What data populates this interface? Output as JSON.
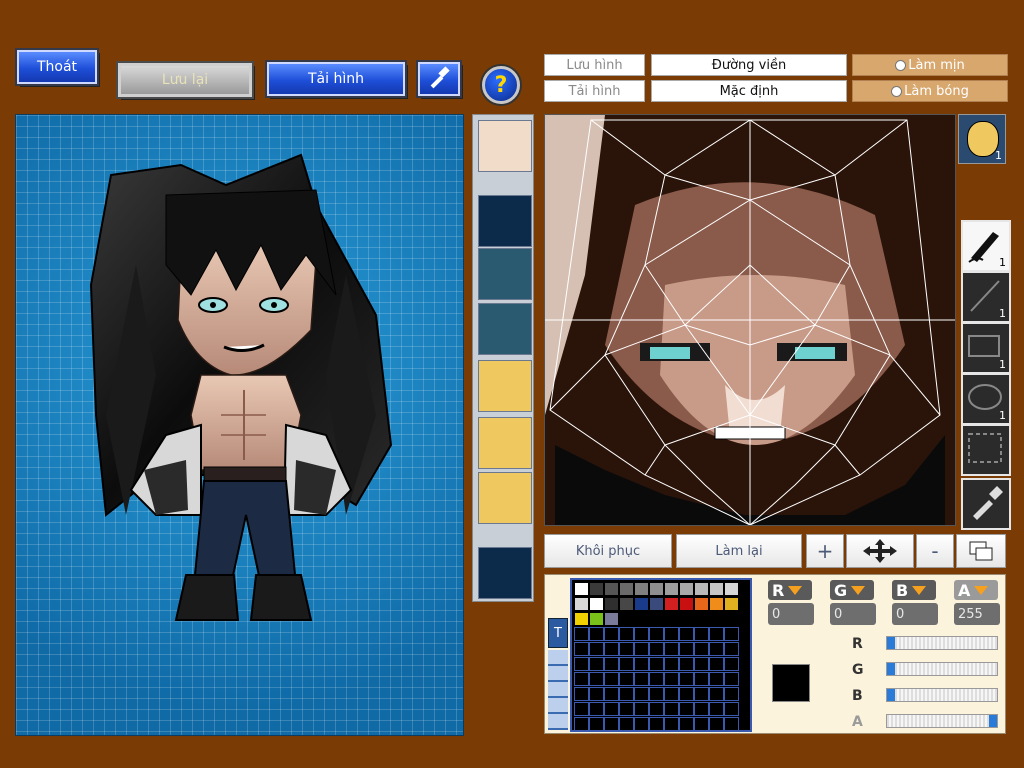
{
  "toolbar": {
    "exit_label": "Thoát",
    "save_label": "Lưu lại",
    "load_label": "Tải hình",
    "help_glyph": "?"
  },
  "face_tabs": {
    "save_image": "Lưu hình",
    "load_image": "Tải hình",
    "outline": "Đường viền",
    "default": "Mặc định",
    "smooth": "Làm mịn",
    "shade": "Làm bóng"
  },
  "face_actions": {
    "restore": "Khôi phục",
    "redo": "Làm lại",
    "plus": "+",
    "minus": "-"
  },
  "tools": [
    {
      "name": "pen-tool",
      "count": "1"
    },
    {
      "name": "line-tool",
      "count": "1"
    },
    {
      "name": "rectangle-tool",
      "count": "1"
    },
    {
      "name": "ellipse-tool",
      "count": "1"
    },
    {
      "name": "select-tool",
      "count": ""
    },
    {
      "name": "eyedropper-tool",
      "count": ""
    }
  ],
  "face_thumb_badge": "1",
  "palette": {
    "tab_label": "T",
    "colors_row1": [
      "#ffffff",
      "#3a3a3a",
      "#555555",
      "#6a6a6a",
      "#808080",
      "#8f8f8f",
      "#9e9e9e",
      "#a8a8a8",
      "#b9b9b9",
      "#c6c6c6",
      "#d6d6d6"
    ],
    "colors_row2": [
      "#d8d8d8",
      "#ffffff",
      "#2f2f2f",
      "#474747",
      "#1a3a8c",
      "#3a4a7a",
      "#d21f1f",
      "#c81010",
      "#e8661a",
      "#f08c1a",
      "#e0b020"
    ],
    "colors_row3": [
      "#f0d000",
      "#7ac21a",
      "#7a7a9a"
    ],
    "current_color": "#000000"
  },
  "channels": {
    "r_value": "0",
    "g_value": "0",
    "b_value": "0",
    "a_value": "255",
    "r_label": "R",
    "g_label": "G",
    "b_label": "B",
    "a_label": "A",
    "r_fraction": 0,
    "g_fraction": 0,
    "b_fraction": 0,
    "a_fraction": 1
  }
}
